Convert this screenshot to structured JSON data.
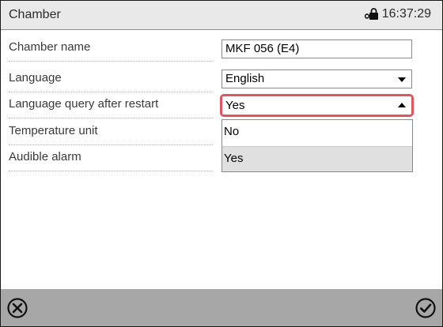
{
  "header": {
    "title": "Chamber",
    "time": "16:37:29"
  },
  "rows": [
    {
      "label": "Chamber name",
      "value": "MKF 056 (E4)"
    },
    {
      "label": "Language",
      "value": "English"
    },
    {
      "label": "Language query after restart",
      "value": "Yes"
    },
    {
      "label": "Temperature unit"
    },
    {
      "label": "Audible alarm"
    }
  ],
  "dropdown": {
    "options": [
      "No",
      "Yes"
    ],
    "selected": "Yes"
  },
  "footer": {
    "cancel_icon": "cancel-circle-x-icon",
    "confirm_icon": "confirm-circle-check-icon"
  },
  "colors": {
    "header_bg": "#e9e9e9",
    "footer_bg": "#a7a7a7",
    "highlight": "#e0565f",
    "selected_option_bg": "#e0e0e0"
  }
}
